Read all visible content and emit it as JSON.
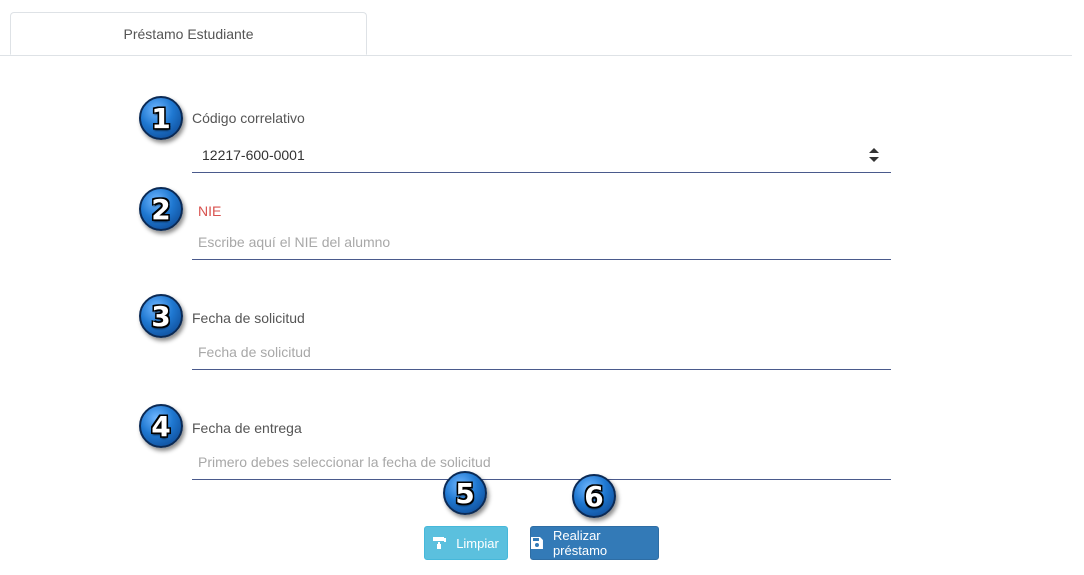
{
  "tabs": [
    {
      "label": "Préstamo Estudiante"
    }
  ],
  "badges": [
    "1",
    "2",
    "3",
    "4",
    "5",
    "6"
  ],
  "form": {
    "codigo": {
      "label": "Código correlativo",
      "value": "12217-600-0001"
    },
    "nie": {
      "label": "NIE",
      "placeholder": "Escribe aquí el NIE del alumno"
    },
    "fecha_solicitud": {
      "label": "Fecha de solicitud",
      "placeholder": "Fecha de solicitud"
    },
    "fecha_entrega": {
      "label": "Fecha de entrega",
      "placeholder": "Primero debes seleccionar la fecha de solicitud"
    }
  },
  "buttons": {
    "clear_label": "Limpiar",
    "clear_icon": "paint-roller-icon",
    "submit_label": "Realizar préstamo",
    "submit_icon": "floppy-disk-icon"
  },
  "colors": {
    "tab_border": "#dee2e6",
    "error_label": "#d9534f",
    "field_underline": "#4a5a8c",
    "clear_button": "#5bc0de",
    "submit_button": "#337ab7",
    "badge": "#1f78d1"
  }
}
